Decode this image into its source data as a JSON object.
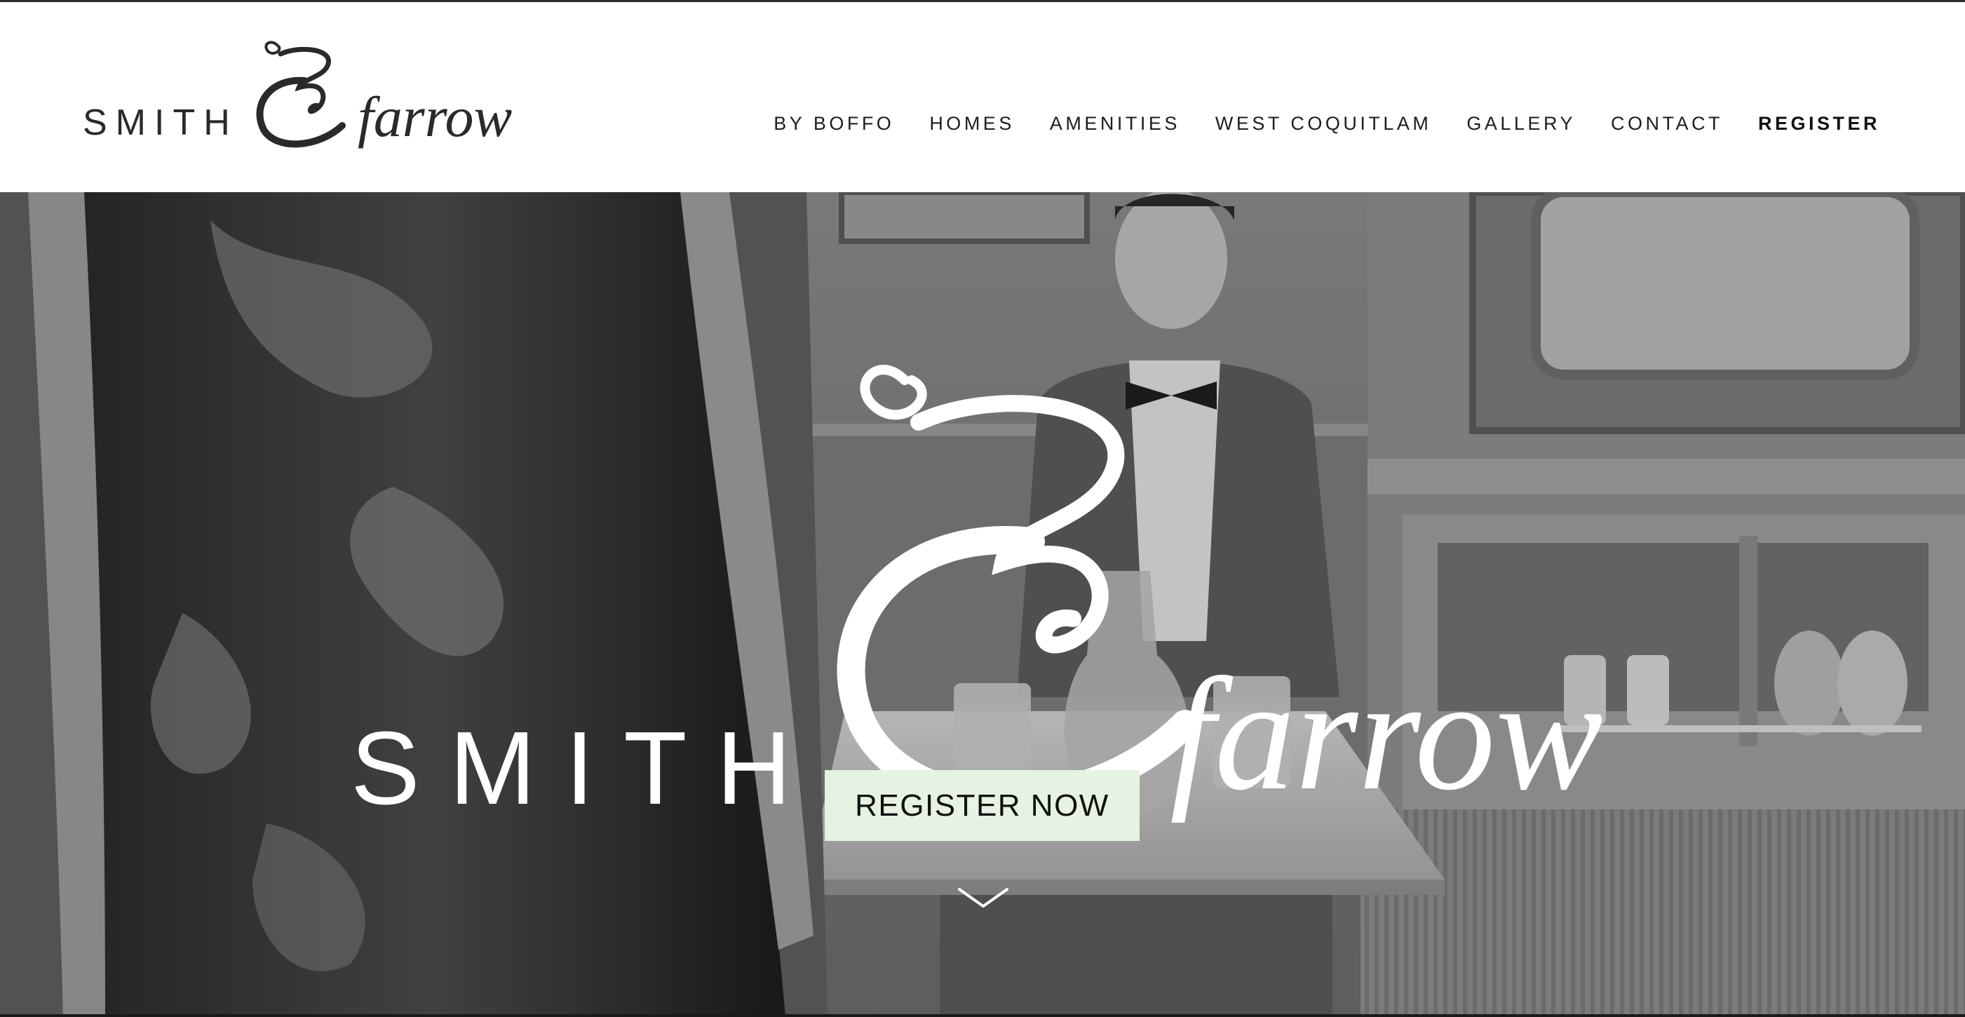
{
  "header": {
    "logo": {
      "smith": "SMITH",
      "farrow": "farrow"
    },
    "nav": [
      {
        "label": "BY BOFFO"
      },
      {
        "label": "HOMES"
      },
      {
        "label": "AMENITIES"
      },
      {
        "label": "WEST COQUITLAM"
      },
      {
        "label": "GALLERY"
      },
      {
        "label": "CONTACT"
      },
      {
        "label": "REGISTER"
      }
    ]
  },
  "hero": {
    "logo": {
      "smith": "SMITH",
      "farrow": "farrow"
    },
    "cta_label": "REGISTER NOW",
    "scroll_icon": "chevron-down-icon"
  },
  "colors": {
    "header_bg": "#ffffff",
    "nav_text": "#1d1d1d",
    "cta_bg": "#e6f3e2",
    "hero_text": "#ffffff"
  }
}
